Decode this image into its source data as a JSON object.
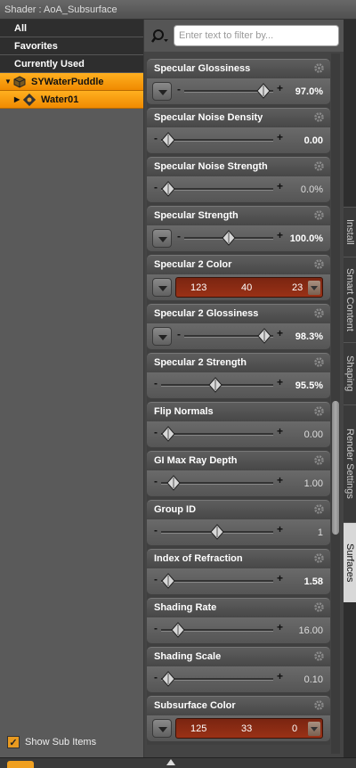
{
  "window": {
    "title": "Shader : AoA_Subsurface"
  },
  "sidebar": {
    "categories": [
      "All",
      "Favorites",
      "Currently Used"
    ],
    "tree": [
      {
        "label": "SYWaterPuddle",
        "level": 0,
        "expanded": true
      },
      {
        "label": "Water01",
        "level": 1,
        "expanded": false
      }
    ],
    "show_sub_items": {
      "label": "Show Sub Items",
      "checked": true
    }
  },
  "filter": {
    "placeholder": "Enter text to filter by...",
    "value": ""
  },
  "properties": [
    {
      "name": "Specular Glossiness",
      "kind": "slider",
      "has_menu": true,
      "value": "97.0%",
      "fraction": 0.97,
      "dim": false
    },
    {
      "name": "Specular Noise Density",
      "kind": "slider",
      "has_menu": false,
      "value": "0.00",
      "fraction": 0.0,
      "dim": false
    },
    {
      "name": "Specular Noise Strength",
      "kind": "slider",
      "has_menu": false,
      "value": "0.0%",
      "fraction": 0.0,
      "dim": true
    },
    {
      "name": "Specular Strength",
      "kind": "slider",
      "has_menu": true,
      "value": "100.0%",
      "fraction": 0.5,
      "dim": false
    },
    {
      "name": "Specular 2 Color",
      "kind": "color",
      "r": "123",
      "g": "40",
      "b": "23"
    },
    {
      "name": "Specular 2 Glossiness",
      "kind": "slider",
      "has_menu": true,
      "value": "98.3%",
      "fraction": 0.98,
      "dim": false
    },
    {
      "name": "Specular 2 Strength",
      "kind": "slider",
      "has_menu": false,
      "value": "95.5%",
      "fraction": 0.48,
      "dim": false
    },
    {
      "name": "Flip Normals",
      "kind": "slider",
      "has_menu": false,
      "value": "0.00",
      "fraction": 0.0,
      "dim": true
    },
    {
      "name": "GI Max Ray Depth",
      "kind": "slider",
      "has_menu": false,
      "value": "1.00",
      "fraction": 0.05,
      "dim": true
    },
    {
      "name": "Group ID",
      "kind": "slider",
      "has_menu": false,
      "value": "1",
      "fraction": 0.5,
      "dim": true
    },
    {
      "name": "Index of Refraction",
      "kind": "slider",
      "has_menu": false,
      "value": "1.58",
      "fraction": 0.0,
      "dim": false
    },
    {
      "name": "Shading Rate",
      "kind": "slider",
      "has_menu": false,
      "value": "16.00",
      "fraction": 0.1,
      "dim": true
    },
    {
      "name": "Shading Scale",
      "kind": "slider",
      "has_menu": false,
      "value": "0.10",
      "fraction": 0.0,
      "dim": true
    },
    {
      "name": "Subsurface Color",
      "kind": "color",
      "r": "125",
      "g": "33",
      "b": "0"
    }
  ],
  "side_tabs": [
    {
      "label": "Install",
      "active": false
    },
    {
      "label": "Smart Content",
      "active": false
    },
    {
      "label": "Shaping",
      "active": false
    },
    {
      "label": "Render Settings",
      "active": false
    },
    {
      "label": "Surfaces",
      "active": true
    }
  ],
  "colors": {
    "accent": "#f39a10",
    "color_swatch": "#8a2c14"
  }
}
